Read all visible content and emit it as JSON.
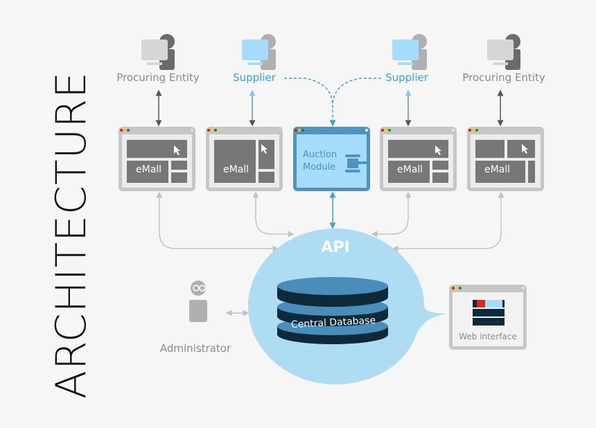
{
  "title": "ARCHITECTURE",
  "actors": [
    {
      "label": "Procuring Entity",
      "type": "procuring-entity",
      "color": "#8a8a8a"
    },
    {
      "label": "Supplier",
      "type": "supplier",
      "color": "#3aa0d5"
    },
    {
      "label": "Supplier",
      "type": "supplier",
      "color": "#3aa0d5"
    },
    {
      "label": "Procuring Entity",
      "type": "procuring-entity",
      "color": "#8a8a8a"
    }
  ],
  "modules": [
    {
      "label": "eMall",
      "layout": "wide-top"
    },
    {
      "label": "eMall",
      "layout": "tall-left"
    },
    {
      "label_line1": "Auction",
      "label_line2": "Module",
      "highlight": true
    },
    {
      "label": "eMall",
      "layout": "wide-top"
    },
    {
      "label": "eMall",
      "layout": "split-top"
    }
  ],
  "api": {
    "label": "API"
  },
  "database": {
    "label": "Central Database"
  },
  "administrator": {
    "label": "Administrator"
  },
  "web_interface": {
    "label": "Web interface"
  },
  "colors": {
    "background": "#f6f6f6",
    "window_frame": "#c6c6c6",
    "window_panel": "#777777",
    "accent_blue": "#3aa0d5",
    "auction_frame": "#4f94c0",
    "auction_fill": "#a5dbfb",
    "api_bubble": "#addcf3",
    "db_dark": "#0c2a3a",
    "db_top": "#4a8dbb"
  }
}
